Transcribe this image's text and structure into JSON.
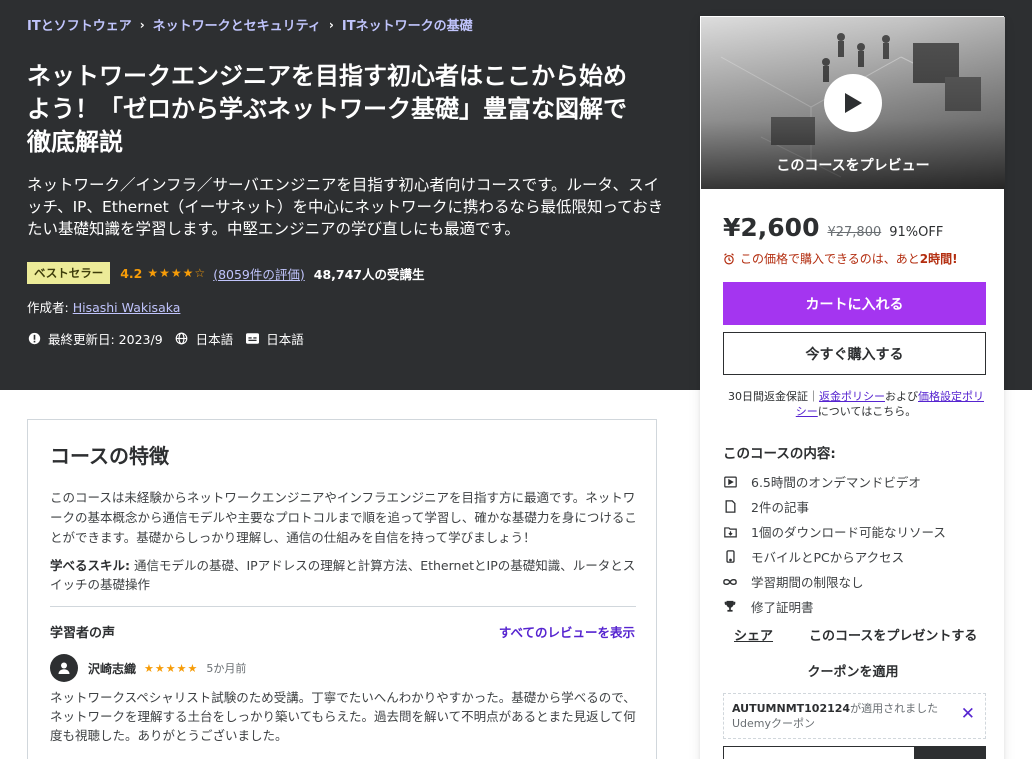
{
  "breadcrumb": [
    "ITとソフトウェア",
    "ネットワークとセキュリティ",
    "ITネットワークの基礎"
  ],
  "course": {
    "title": "ネットワークエンジニアを目指す初心者はここから始めよう！「ゼロから学ぶネットワーク基礎」豊富な図解で徹底解説",
    "headline": "ネットワーク／インフラ／サーバエンジニアを目指す初心者向けコースです。ルータ、スイッチ、IP、Ethernet（イーサネット）を中心にネットワークに携わるなら最低限知っておきたい基礎知識を学習します。中堅エンジニアの学び直しにも最適です。",
    "badge": "ベストセラー",
    "rating": "4.2",
    "stars": "★★★★☆",
    "rating_count": "(8059件の評価)",
    "students": "48,747人の受講生",
    "author_label": "作成者:",
    "author": "Hisashi Wakisaka",
    "updated": "最終更新日: 2023/9",
    "language": "日本語",
    "caption": "日本語"
  },
  "features": {
    "title": "コースの特徴",
    "description": "このコースは未経験からネットワークエンジニアやインフラエンジニアを目指す方に最適です。ネットワークの基本概念から通信モデルや主要なプロトコルまで順を追って学習し、確かな基礎力を身につけることができます。基礎からしっかり理解し、通信の仕組みを自信を持って学びましょう！",
    "skills_label": "学べるスキル:",
    "skills": " 通信モデルの基礎、IPアドレスの理解と計算方法、EthernetとIPの基礎知識、ルータとスイッチの基礎操作",
    "reviews_title": "学習者の声",
    "reviews_link": "すべてのレビューを表示",
    "review": {
      "name": "沢崎志織",
      "stars": "★★★★★",
      "when": "5か月前",
      "text": "ネットワークスペシャリスト試験のため受講。丁寧でたいへんわかりやすかった。基礎から学べるので、ネットワークを理解する土台をしっかり築いてもらえた。過去問を解いて不明点があるとまた見返して何度も視聴した。ありがとうございました。"
    }
  },
  "sidebar": {
    "preview_label": "このコースをプレビュー",
    "price": "¥2,600",
    "original_price": "¥27,800",
    "discount": "91%OFF",
    "timer_text": "この価格で購入できるのは、あと",
    "timer_value": "2時間!",
    "cart_button": "カートに入れる",
    "buy_button": "今すぐ購入する",
    "guarantee_prefix": "30日間返金保証｜",
    "refund_policy": "返金ポリシー",
    "and": "および",
    "pricing_policy": "価格設定ポリシー",
    "guarantee_suffix": "についてはこちら。",
    "includes_title": "このコースの内容:",
    "includes": [
      {
        "icon": "video-icon",
        "text": "6.5時間のオンデマンドビデオ"
      },
      {
        "icon": "article-icon",
        "text": "2件の記事"
      },
      {
        "icon": "download-icon",
        "text": "1個のダウンロード可能なリソース"
      },
      {
        "icon": "mobile-icon",
        "text": "モバイルとPCからアクセス"
      },
      {
        "icon": "infinity-icon",
        "text": "学習期間の制限なし"
      },
      {
        "icon": "trophy-icon",
        "text": "修了証明書"
      }
    ],
    "share": "シェア",
    "gift": "このコースをプレゼントする",
    "apply_coupon": "クーポンを適用",
    "coupon_code": "AUTUMNMT102124",
    "coupon_applied": "が適用されました",
    "coupon_type": "Udemyクーポン"
  }
}
